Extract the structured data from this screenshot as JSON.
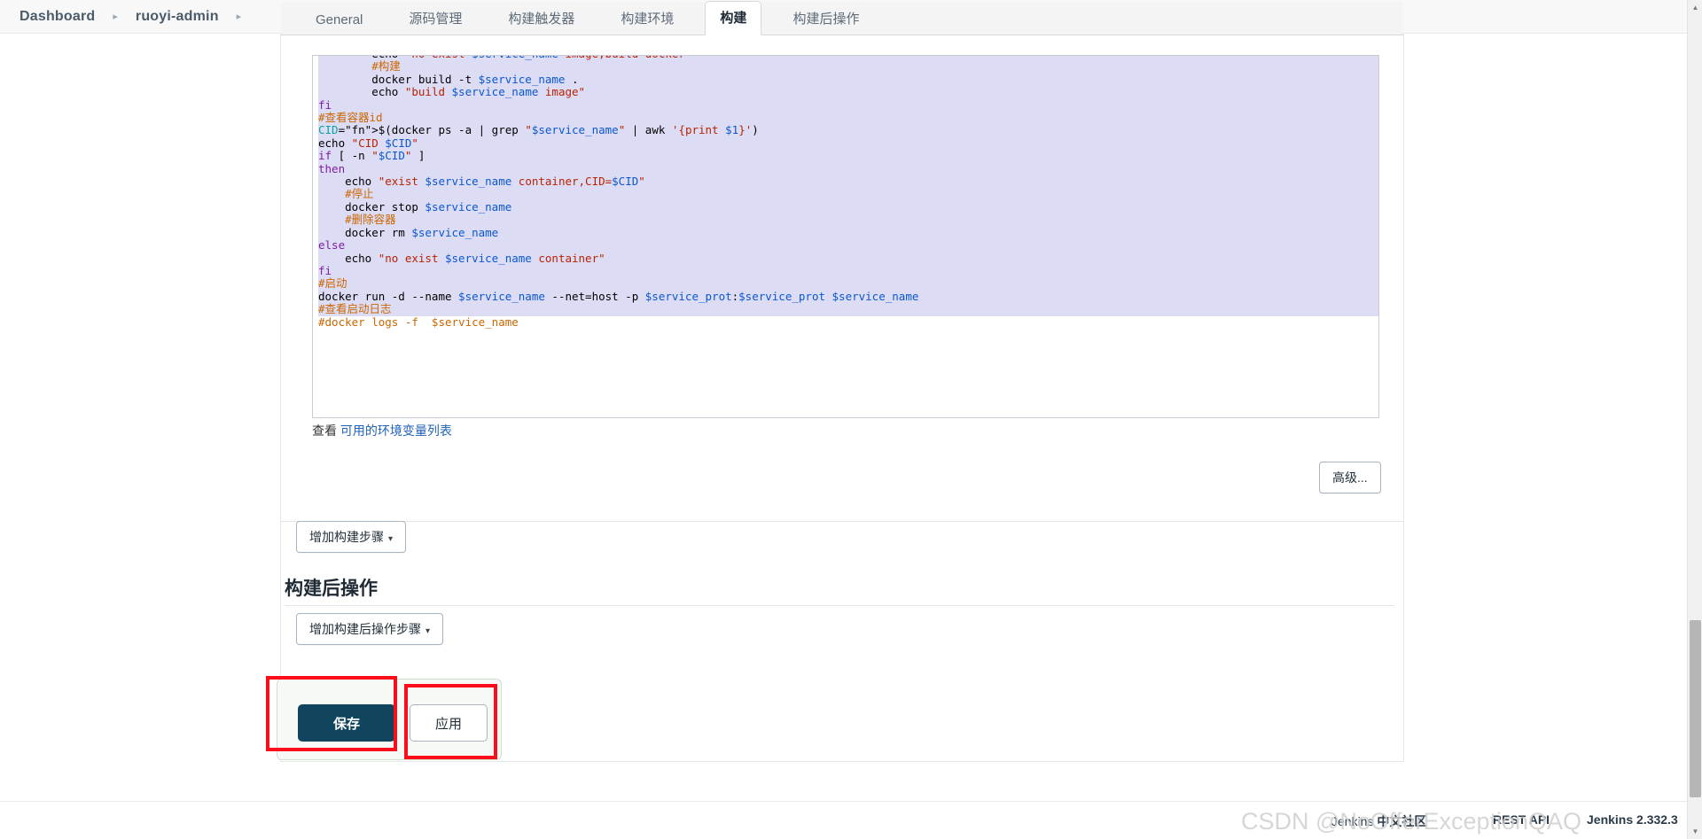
{
  "breadcrumb": {
    "items": [
      {
        "label": "Dashboard"
      },
      {
        "label": "ruoyi-admin"
      }
    ],
    "separator": "▸"
  },
  "tabs": [
    {
      "label": "General",
      "active": false
    },
    {
      "label": "源码管理",
      "active": false
    },
    {
      "label": "构建触发器",
      "active": false
    },
    {
      "label": "构建环境",
      "active": false
    },
    {
      "label": "构建",
      "active": true
    },
    {
      "label": "构建后操作",
      "active": false
    }
  ],
  "editor": {
    "lines": [
      "        echo \"no exist $service_name image,build docker\"",
      "        #构建",
      "        docker build -t $service_name .",
      "        echo \"build $service_name image\"",
      "fi",
      "#查看容器id",
      "CID=$(docker ps -a | grep \"$service_name\" | awk '{print $1}')",
      "echo \"CID $CID\"",
      "if [ -n \"$CID\" ]",
      "then",
      "    echo \"exist $service_name container,CID=$CID\"",
      "    #停止",
      "    docker stop $service_name",
      "    #删除容器",
      "    docker rm $service_name",
      "else",
      "    echo \"no exist $service_name container\"",
      "fi",
      "#启动",
      "docker run -d --name $service_name --net=host -p $service_prot:$service_prot $service_name",
      "#查看启动日志",
      "#docker logs -f  $service_name"
    ]
  },
  "env_link": {
    "prefix": "查看 ",
    "link_text": "可用的环境变量列表"
  },
  "buttons": {
    "advanced": "高级...",
    "add_build_step": "增加构建步骤",
    "add_post_build_step": "增加构建后操作步骤",
    "save": "保存",
    "apply": "应用",
    "dropdown_caret": "▾"
  },
  "post_build": {
    "title": "构建后操作"
  },
  "footer": {
    "community_prefix": "Jenkins ",
    "community_suffix": "中文社区",
    "rest_api": "REST API",
    "version": "Jenkins 2.332.3",
    "watermark": "CSDN @NoOfferExceptionQAQ"
  },
  "scrollbar": {
    "up_arrow": "▲",
    "down_arrow": "▼"
  },
  "colors": {
    "save_button_bg": "#11455e",
    "annotation_red": "#fc0d1c",
    "tab_strip_bg": "#f4f4f4",
    "code_selection": "#dcdcf5"
  }
}
